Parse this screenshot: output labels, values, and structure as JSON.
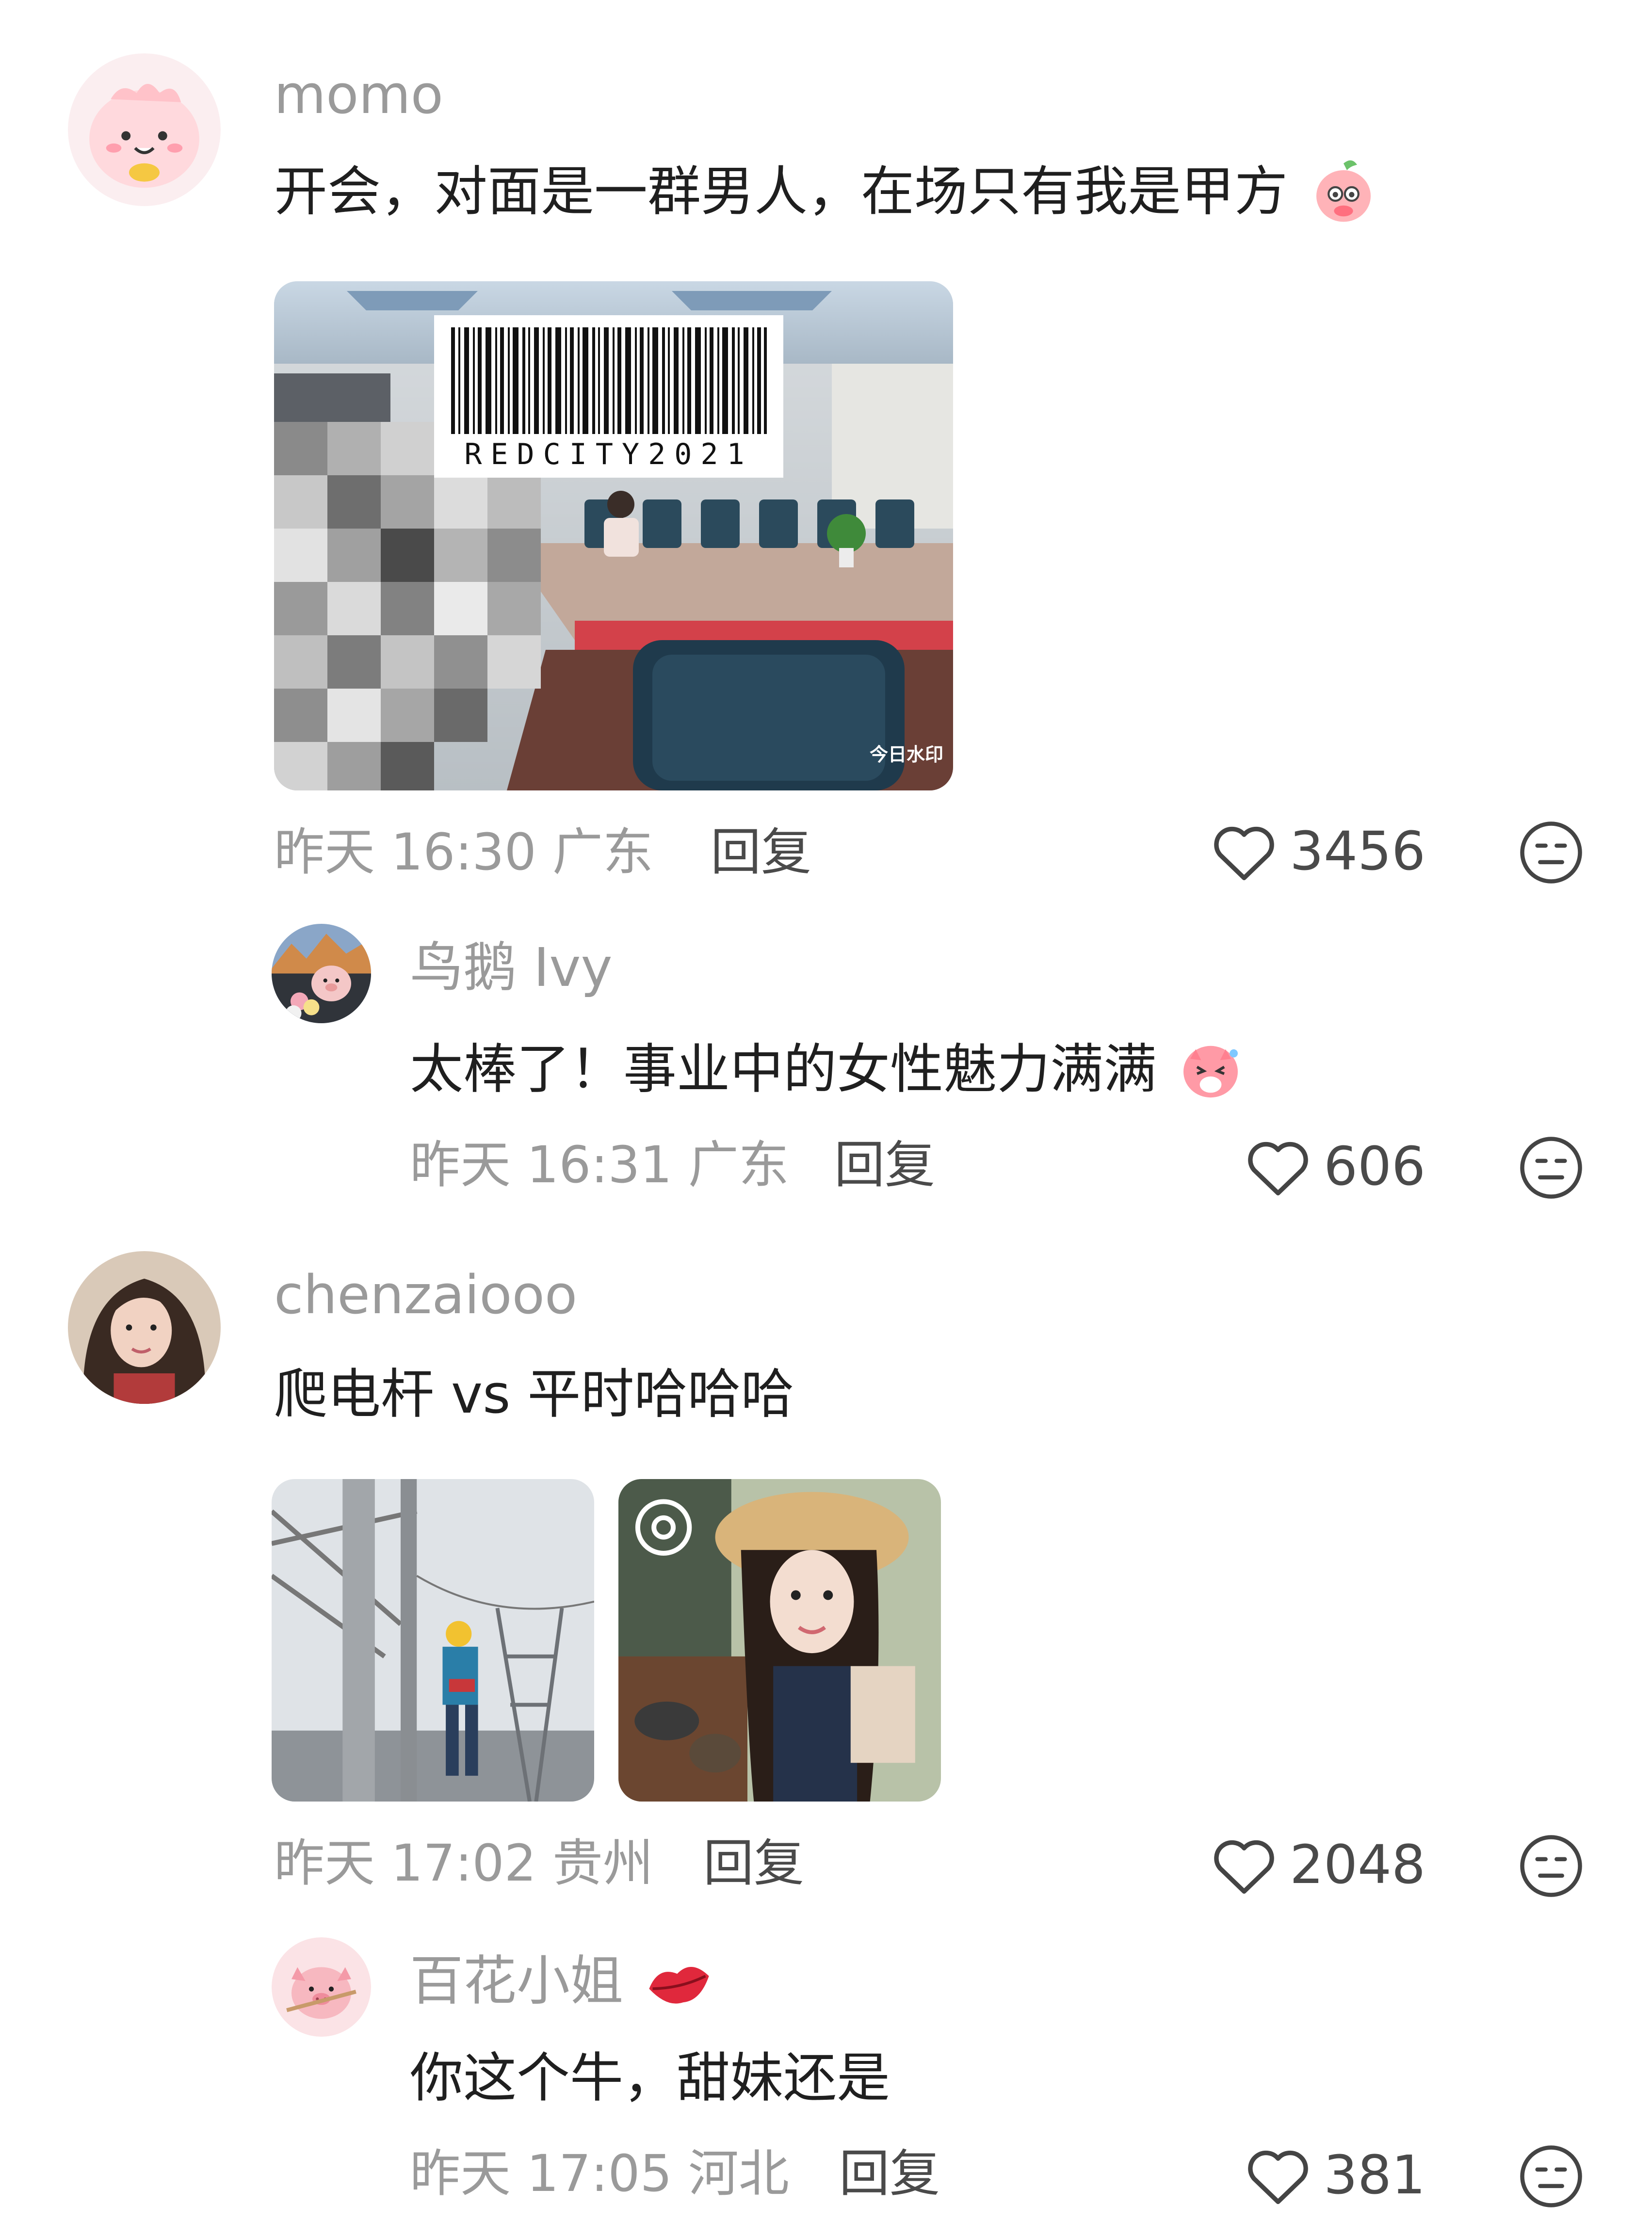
{
  "comments": [
    {
      "username": "momo",
      "text": "开会，对面是一群男人，在场只有我是甲方",
      "time": "昨天 16:30",
      "location": "广东",
      "reply_label": "回复",
      "likes": "3456",
      "image_barcode_text": "REDCITY2021",
      "image_watermark": "今日水印",
      "replies": [
        {
          "username": "鸟鹅 Ivy",
          "text": "太棒了！事业中的女性魅力满满",
          "time": "昨天 16:31",
          "location": "广东",
          "reply_label": "回复",
          "likes": "606"
        }
      ]
    },
    {
      "username": "chenzaiooo",
      "text": "爬电杆 vs 平时哈哈哈",
      "time": "昨天 17:02",
      "location": "贵州",
      "reply_label": "回复",
      "likes": "2048",
      "replies": [
        {
          "username": "百花小姐",
          "text": "你这个牛，甜妹还是",
          "time": "昨天 17:05",
          "location": "河北",
          "reply_label": "回复",
          "likes": "381"
        }
      ]
    }
  ],
  "icons": {
    "like": "heart-outline-icon",
    "dislike": "neutral-face-icon"
  },
  "colors": {
    "username": "#9a9a9a",
    "text": "#1f1f1f",
    "meta": "#9a9a9a",
    "reply": "#4a4a4a",
    "lips": "#e0283c"
  }
}
